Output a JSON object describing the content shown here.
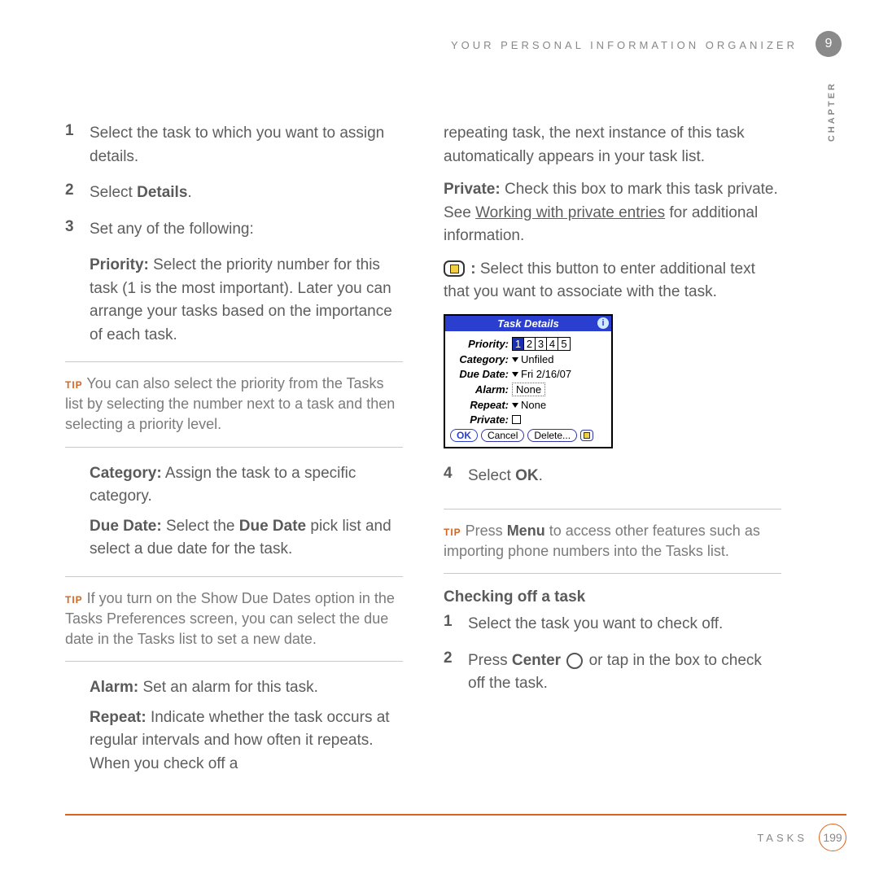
{
  "header": {
    "title": "YOUR PERSONAL INFORMATION ORGANIZER"
  },
  "chapter": {
    "number": "9",
    "label": "CHAPTER"
  },
  "left": {
    "step1": "Select the task to which you want to assign details.",
    "step2_pre": "Select ",
    "step2_bold": "Details",
    "step2_post": ".",
    "step3": "Set any of the following:",
    "priority_label": "Priority:",
    "priority_text": " Select the priority number for this task (1 is the most important). Later you can arrange your tasks based on the importance of each task.",
    "tip1_label": "TIP",
    "tip1": " You can also select the priority from the Tasks list by selecting the number next to a task and then selecting a priority level.",
    "category_label": "Category:",
    "category_text": " Assign the task to a specific category.",
    "duedate_label": "Due Date:",
    "duedate_text_pre": " Select the ",
    "duedate_bold": "Due Date",
    "duedate_text_post": " pick list and select a due date for the task.",
    "tip2_label": "TIP",
    "tip2": " If you turn on the Show Due Dates option in the Tasks Preferences screen, you can select the due date in the Tasks list to set a new date.",
    "alarm_label": "Alarm:",
    "alarm_text": " Set an alarm for this task.",
    "repeat_label": "Repeat:",
    "repeat_text": " Indicate whether the task occurs at regular intervals and how often it repeats. When you check off a"
  },
  "right": {
    "cont": "repeating task, the next instance of this task automatically appears in your task list.",
    "private_label": "Private:",
    "private_text_pre": " Check this box to mark this task private. See ",
    "private_link": "Working with private entries",
    "private_text_post": " for additional information.",
    "note_colon": " :",
    "note_text": " Select this button to enter additional text that you want to associate with the task.",
    "step4_pre": "Select ",
    "step4_bold": "OK",
    "step4_post": ".",
    "tip3_label": "TIP",
    "tip3_pre": " Press ",
    "tip3_bold": "Menu",
    "tip3_post": " to access other features such as importing phone numbers into the Tasks list.",
    "subhead": "Checking off a task",
    "c1": "Select the task you want to check off.",
    "c2_pre": "Press ",
    "c2_bold": "Center",
    "c2_post": " or tap in the box to check off the task."
  },
  "dialog": {
    "title": "Task Details",
    "rows": {
      "priority": "Priority:",
      "category": "Category:",
      "category_val": "Unfiled",
      "duedate": "Due Date:",
      "duedate_val": "Fri 2/16/07",
      "alarm": "Alarm:",
      "alarm_val": "None",
      "repeat": "Repeat:",
      "repeat_val": "None",
      "private": "Private:"
    },
    "prio": [
      "1",
      "2",
      "3",
      "4",
      "5"
    ],
    "buttons": {
      "ok": "OK",
      "cancel": "Cancel",
      "delete": "Delete..."
    }
  },
  "footer": {
    "section": "TASKS",
    "page": "199"
  }
}
